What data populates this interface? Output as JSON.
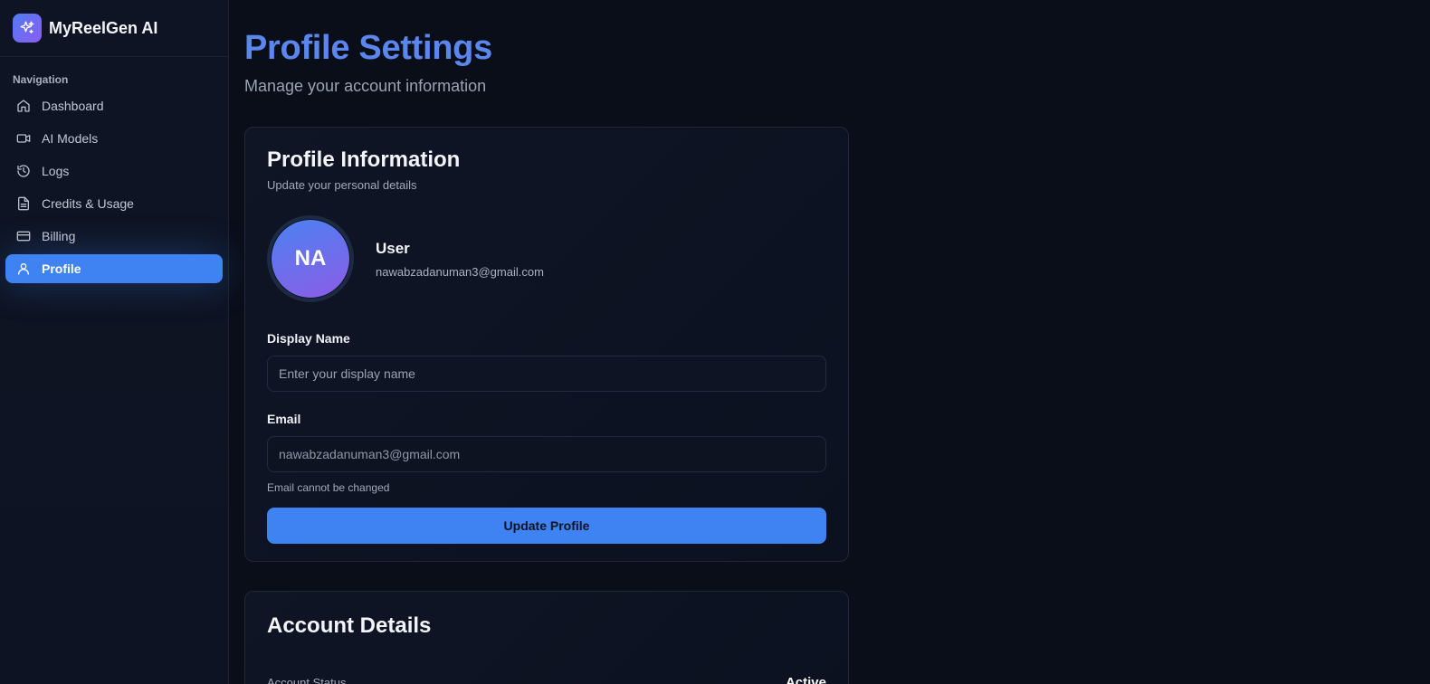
{
  "brand": {
    "name": "MyReelGen AI",
    "icon": "sparkles-icon"
  },
  "sidebar": {
    "heading": "Navigation",
    "items": [
      {
        "label": "Dashboard",
        "icon": "home-icon",
        "active": false
      },
      {
        "label": "AI Models",
        "icon": "video-camera-icon",
        "active": false
      },
      {
        "label": "Logs",
        "icon": "history-icon",
        "active": false
      },
      {
        "label": "Credits & Usage",
        "icon": "document-icon",
        "active": false
      },
      {
        "label": "Billing",
        "icon": "credit-card-icon",
        "active": false
      },
      {
        "label": "Profile",
        "icon": "user-icon",
        "active": true
      }
    ]
  },
  "page": {
    "title": "Profile Settings",
    "subtitle": "Manage your account information"
  },
  "profile_card": {
    "title": "Profile Information",
    "subtitle": "Update your personal details",
    "avatar_initials": "NA",
    "user_name": "User",
    "user_email": "nawabzadanuman3@gmail.com",
    "display_name_label": "Display Name",
    "display_name_value": "",
    "display_name_placeholder": "Enter your display name",
    "email_label": "Email",
    "email_value": "nawabzadanuman3@gmail.com",
    "email_hint": "Email cannot be changed",
    "submit_label": "Update Profile"
  },
  "account_card": {
    "title": "Account Details",
    "status_label": "Account Status",
    "status_value": "Active"
  },
  "colors": {
    "accent": "#3f82f1",
    "title": "#5b86ee",
    "avatar_start": "#4b82f2",
    "avatar_end": "#8c5ce6",
    "background": "#0a0e19"
  }
}
